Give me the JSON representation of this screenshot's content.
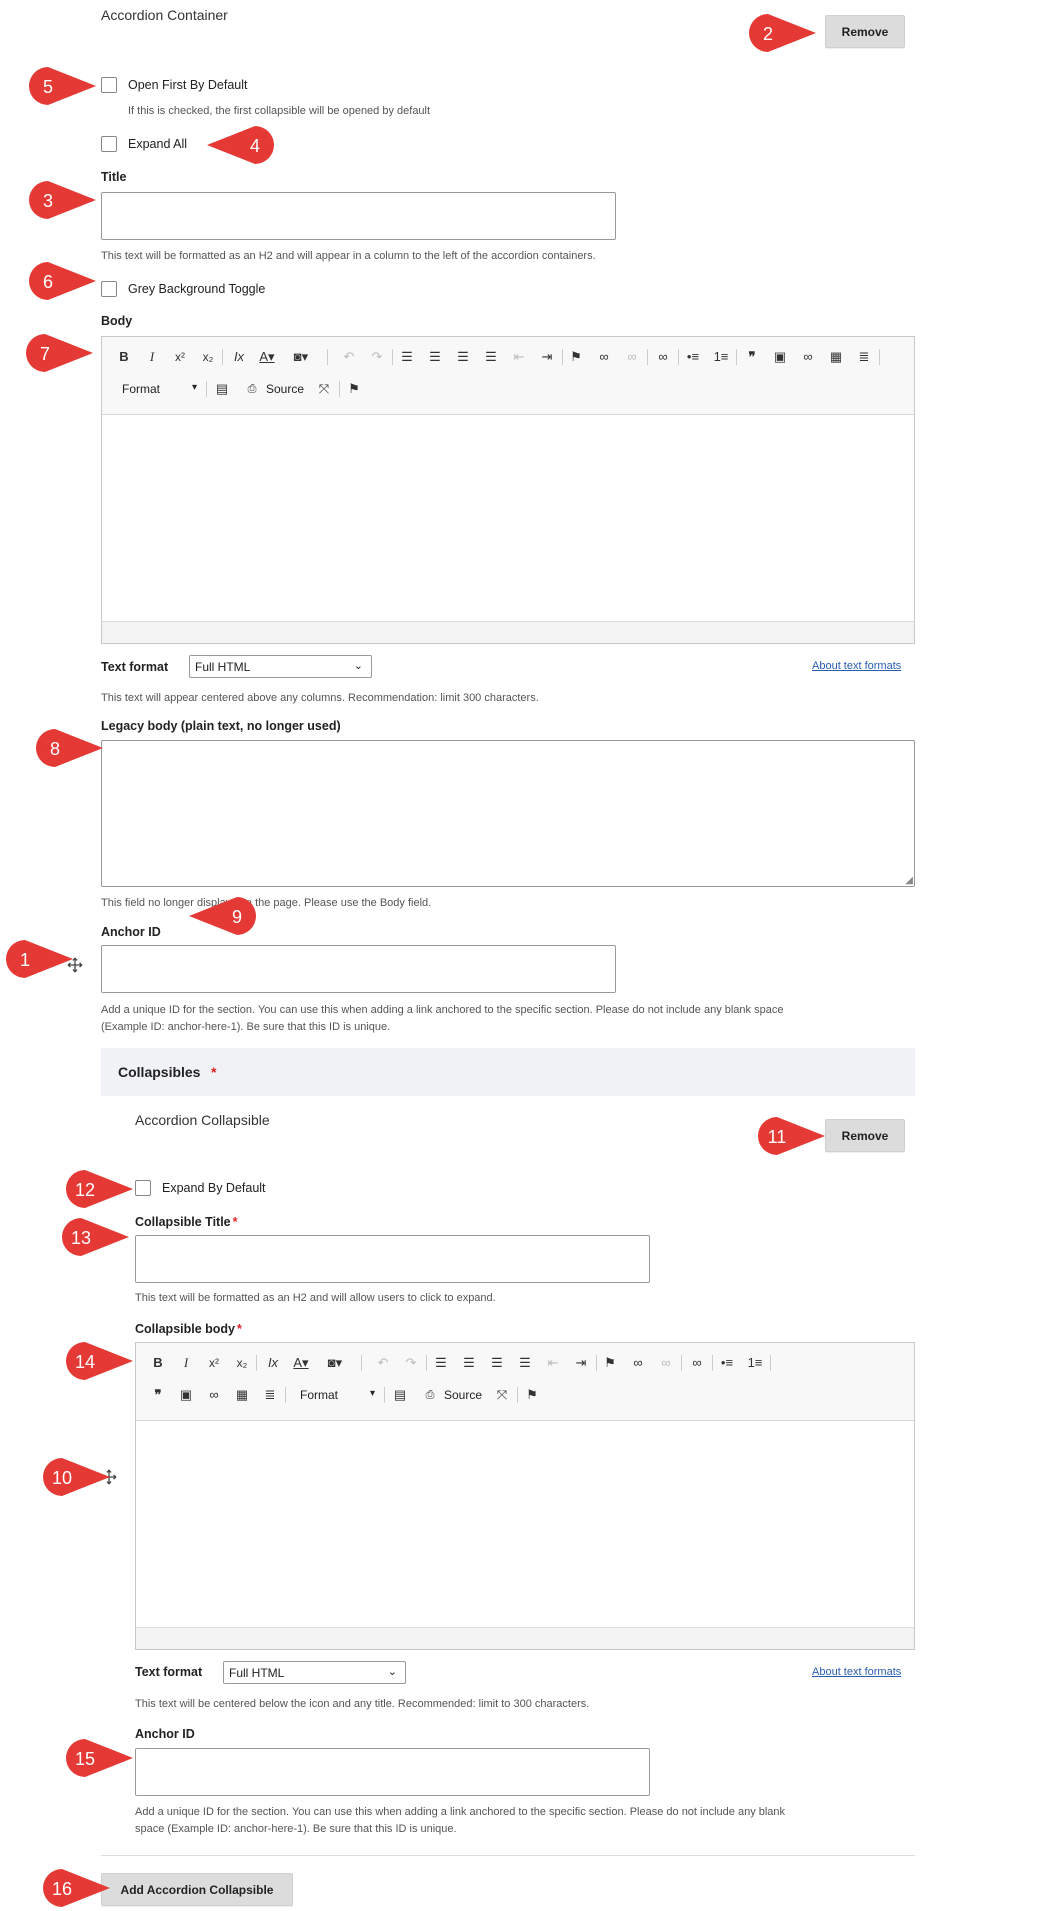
{
  "accordion_container": {
    "heading": "Accordion Container",
    "remove_label": "Remove",
    "open_first_label": "Open First By Default",
    "open_first_help": "If this is checked, the first collapsible will be opened by default",
    "expand_all_label": "Expand All",
    "title_label": "Title",
    "title_value": "",
    "title_help": "This text will be formatted as an H2 and will appear in a column to the left of the accordion containers.",
    "grey_bg_label": "Grey Background Toggle",
    "body_label": "Body",
    "format_label": "Format",
    "source_label": "Source",
    "text_format_label": "Text format",
    "text_format_value": "Full HTML",
    "about_formats": "About text formats",
    "body_help": "This text will appear centered above any columns. Recommendation: limit 300 characters.",
    "legacy_label": "Legacy body (plain text, no longer used)",
    "legacy_help": "This field no longer displays on the page. Please use the Body field.",
    "anchor_label": "Anchor ID",
    "anchor_help_1": "Add a unique ID for the section. You can use this when adding a link anchored to the specific section. Please do not include any blank space",
    "anchor_help_2": "(Example ID: anchor-here-1). Be sure that this ID is unique."
  },
  "collapsibles": {
    "section_label": "Collapsibles",
    "required_mark": "*",
    "item_heading": "Accordion Collapsible",
    "remove_label": "Remove",
    "expand_default_label": "Expand By Default",
    "title_label": "Collapsible Title",
    "title_help": "This text will be formatted as an H2 and will allow users to click to expand.",
    "body_label": "Collapsible body",
    "format_label": "Format",
    "source_label": "Source",
    "text_format_label": "Text format",
    "text_format_value": "Full HTML",
    "about_formats": "About text formats",
    "body_help": "This text will be centered below the icon and any title. Recommended: limit to 300 characters.",
    "anchor_label": "Anchor ID",
    "anchor_help_1": "Add a unique ID for the section. You can use this when adding a link anchored to the specific section. Please do not include any blank",
    "anchor_help_2": "space (Example ID: anchor-here-1). Be sure that this ID is unique.",
    "add_button": "Add Accordion Collapsible"
  },
  "markers": [
    "1",
    "2",
    "3",
    "4",
    "5",
    "6",
    "7",
    "8",
    "9",
    "10",
    "11",
    "12",
    "13",
    "14",
    "15",
    "16"
  ],
  "colors": {
    "marker": "#e53935",
    "link": "#2a5db0",
    "button": "#dcdcdc",
    "required": "#dd2222"
  },
  "toolbar_icons": [
    "bold",
    "italic",
    "superscript",
    "subscript",
    "remove-format",
    "text-color",
    "bg-color",
    "undo",
    "redo",
    "align-left",
    "align-center",
    "align-right",
    "justify",
    "outdent",
    "indent",
    "flag",
    "link",
    "unlink",
    "link",
    "bulleted-list",
    "numbered-list",
    "blockquote",
    "image",
    "link",
    "table",
    "horizontal-rule",
    "format",
    "paste-text",
    "source",
    "maximize",
    "flag"
  ]
}
